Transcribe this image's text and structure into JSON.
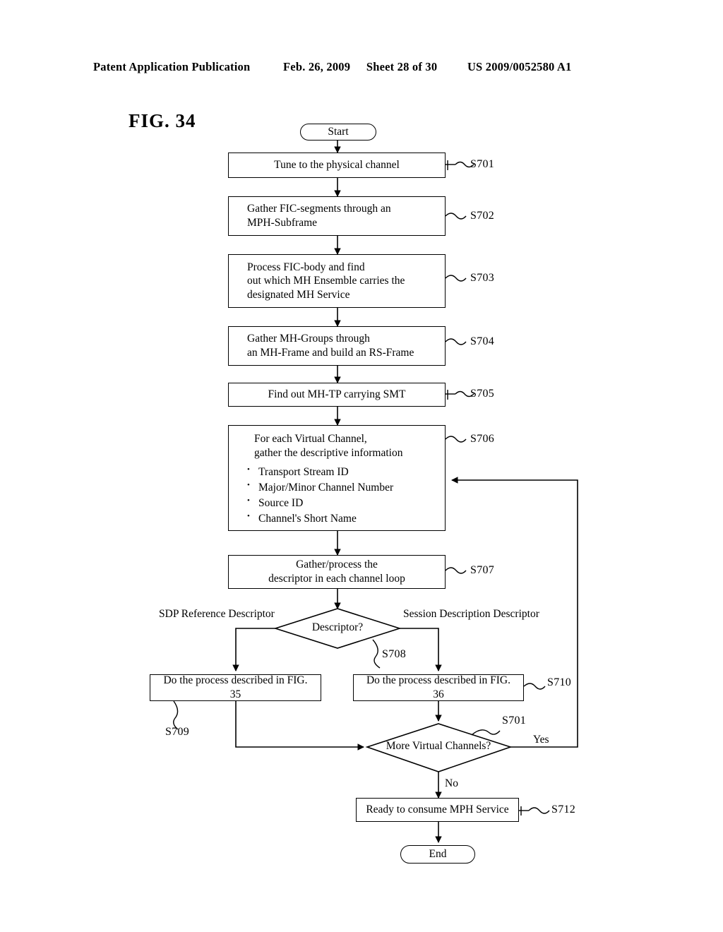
{
  "header": {
    "publication": "Patent Application Publication",
    "date": "Feb. 26, 2009",
    "sheet": "Sheet 28 of 30",
    "patent_number": "US 2009/0052580 A1"
  },
  "figure": {
    "label": "FIG. 34"
  },
  "flowchart": {
    "start_node": "Start",
    "end_node": "End",
    "steps": {
      "s701": {
        "ref": "S701",
        "text": "Tune to the physical channel"
      },
      "s702": {
        "ref": "S702",
        "line1": "Gather FIC-segments through an",
        "line2": "MPH-Subframe"
      },
      "s703": {
        "ref": "S703",
        "line1": "Process FIC-body and find",
        "line2": "out which MH Ensemble carries the",
        "line3": "designated MH Service"
      },
      "s704": {
        "ref": "S704",
        "line1": "Gather MH-Groups through",
        "line2": "an MH-Frame and build an RS-Frame"
      },
      "s705": {
        "ref": "S705",
        "text": "Find out MH-TP carrying SMT"
      },
      "s706": {
        "ref": "S706",
        "line1": "For each Virtual Channel,",
        "line2": "gather the descriptive information",
        "bullets": [
          "Transport Stream ID",
          "Major/Minor Channel Number",
          "Source ID",
          "Channel's Short  Name"
        ]
      },
      "s707": {
        "ref": "S707",
        "line1": "Gather/process the",
        "line2": "descriptor in each channel loop"
      },
      "s708": {
        "ref": "S708",
        "text": "Descriptor?",
        "branch_left": "SDP Reference Descriptor",
        "branch_right": "Session Description Descriptor"
      },
      "s709": {
        "ref": "S709",
        "text": "Do the process described in FIG. 35"
      },
      "s710": {
        "ref": "S710",
        "text": "Do the process described in FIG. 36"
      },
      "s711": {
        "ref": "S701",
        "text": "More Virtual Channels?",
        "branch_yes": "Yes",
        "branch_no": "No"
      },
      "s712": {
        "ref": "S712",
        "text": "Ready to consume MPH Service"
      }
    }
  },
  "colors": {
    "ink": "#000000",
    "paper": "#ffffff"
  }
}
